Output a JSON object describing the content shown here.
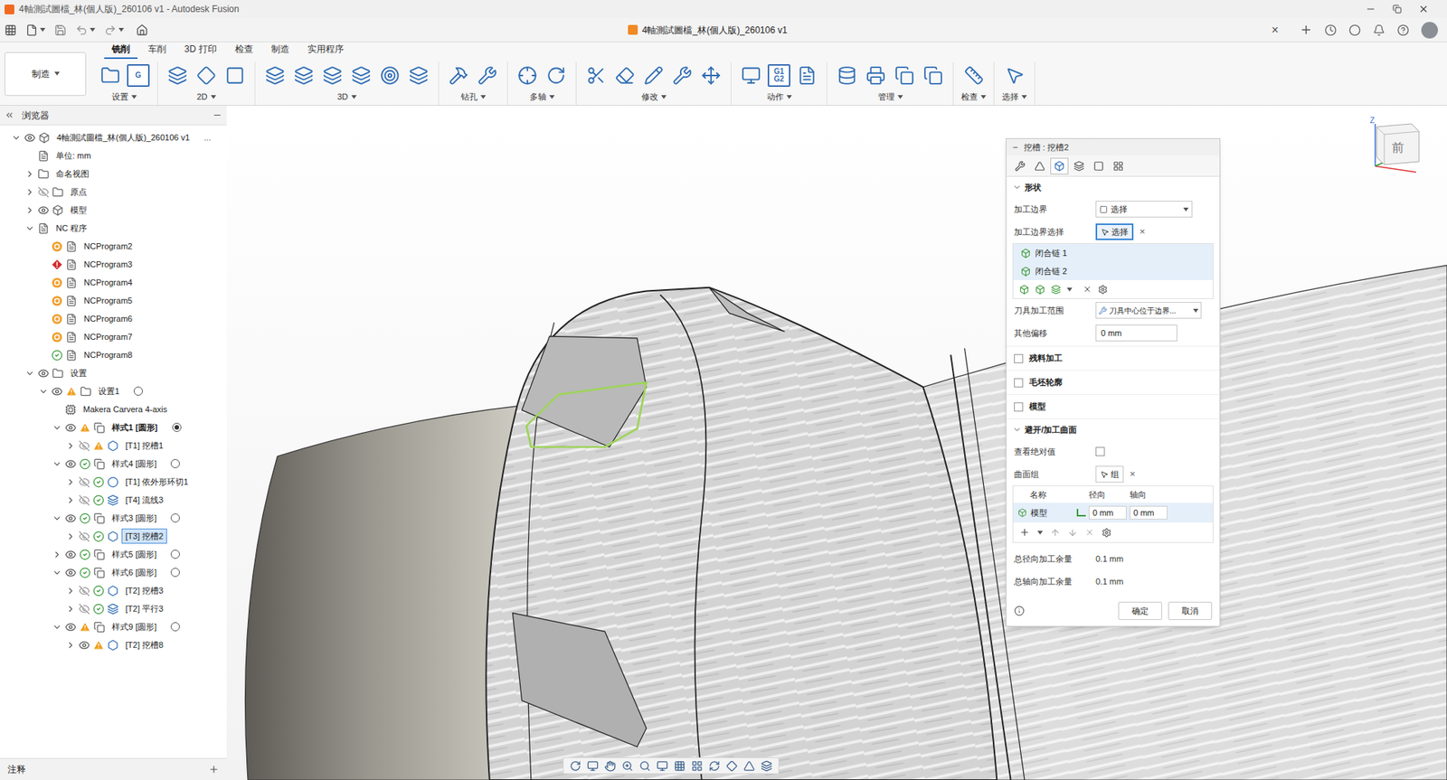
{
  "window": {
    "title": "4軸測試圖檔_林(個人版)_260106 v1 - Autodesk Fusion"
  },
  "document_tab": {
    "title": "4軸測試圖檔_林(個人版)_260106 v1",
    "close": "×"
  },
  "workspace": "制造",
  "ribbon_tabs": [
    {
      "label": "铣削",
      "selected": true
    },
    {
      "label": "车削",
      "selected": false
    },
    {
      "label": "3D 打印",
      "selected": false
    },
    {
      "label": "检查",
      "selected": false
    },
    {
      "label": "制造",
      "selected": false
    },
    {
      "label": "实用程序",
      "selected": false
    }
  ],
  "ribbon_groups": [
    {
      "label": "设置",
      "tools": [
        {
          "kind": "setup"
        },
        {
          "kind": "nc-program",
          "text": "G"
        }
      ]
    },
    {
      "label": "2D",
      "tools": [
        {
          "kind": "adaptive2d"
        },
        {
          "kind": "pocket2d"
        },
        {
          "kind": "face"
        }
      ]
    },
    {
      "label": "3D",
      "tools": [
        {
          "kind": "adaptive"
        },
        {
          "kind": "pocket"
        },
        {
          "kind": "steep"
        },
        {
          "kind": "flow"
        },
        {
          "kind": "radial"
        },
        {
          "kind": "parallel"
        }
      ]
    },
    {
      "label": "钻孔",
      "tools": [
        {
          "kind": "drill"
        },
        {
          "kind": "bore"
        }
      ]
    },
    {
      "label": "多轴",
      "tools": [
        {
          "kind": "swarf"
        },
        {
          "kind": "rotary"
        }
      ]
    },
    {
      "label": "修改",
      "tools": [
        {
          "kind": "trim"
        },
        {
          "kind": "delete"
        },
        {
          "kind": "edit"
        },
        {
          "kind": "tool-adjust"
        },
        {
          "kind": "move"
        }
      ]
    },
    {
      "label": "动作",
      "tools": [
        {
          "kind": "simulate"
        },
        {
          "kind": "post",
          "text": "G1 G2"
        },
        {
          "kind": "sheet"
        }
      ]
    },
    {
      "label": "管理",
      "tools": [
        {
          "kind": "library"
        },
        {
          "kind": "machine"
        },
        {
          "kind": "template"
        },
        {
          "kind": "copy"
        }
      ]
    },
    {
      "label": "检查",
      "tools": [
        {
          "kind": "measure"
        }
      ]
    },
    {
      "label": "选择",
      "tools": [
        {
          "kind": "select"
        }
      ]
    }
  ],
  "browser": {
    "title": "浏览器",
    "items": [
      {
        "label": "4軸測試圖檔_林(個人版)_260106 v1",
        "more": "...",
        "level": 0,
        "expanded": true,
        "eye": "visible",
        "status": null,
        "icon": "doc",
        "radio": null,
        "selected": false,
        "bold": false
      },
      {
        "label": "单位: mm",
        "level": 1,
        "expanded": null,
        "eye": null,
        "status": null,
        "icon": "units",
        "radio": null,
        "selected": false,
        "bold": false
      },
      {
        "label": "命名视图",
        "level": 1,
        "expanded": false,
        "eye": null,
        "status": null,
        "icon": "folder",
        "radio": null,
        "selected": false,
        "bold": false
      },
      {
        "label": "原点",
        "level": 1,
        "expanded": false,
        "eye": "hidden",
        "status": null,
        "icon": "folder",
        "radio": null,
        "selected": false,
        "bold": false
      },
      {
        "label": "模型",
        "level": 1,
        "expanded": false,
        "eye": "visible",
        "status": null,
        "icon": "component",
        "radio": null,
        "selected": false,
        "bold": false
      },
      {
        "label": "NC 程序",
        "level": 1,
        "expanded": true,
        "eye": null,
        "status": null,
        "icon": "nc-folder",
        "radio": null,
        "selected": false,
        "bold": false
      },
      {
        "label": "NCProgram2",
        "level": 2,
        "expanded": null,
        "eye": null,
        "status": "caution",
        "icon": "nc",
        "radio": null,
        "selected": false,
        "bold": false
      },
      {
        "label": "NCProgram3",
        "level": 2,
        "expanded": null,
        "eye": null,
        "status": "error",
        "icon": "nc",
        "radio": null,
        "selected": false,
        "bold": false
      },
      {
        "label": "NCProgram4",
        "level": 2,
        "expanded": null,
        "eye": null,
        "status": "caution",
        "icon": "nc",
        "radio": null,
        "selected": false,
        "bold": false
      },
      {
        "label": "NCProgram5",
        "level": 2,
        "expanded": null,
        "eye": null,
        "status": "caution",
        "icon": "nc",
        "radio": null,
        "selected": false,
        "bold": false
      },
      {
        "label": "NCProgram6",
        "level": 2,
        "expanded": null,
        "eye": null,
        "status": "caution",
        "icon": "nc",
        "radio": null,
        "selected": false,
        "bold": false
      },
      {
        "label": "NCProgram7",
        "level": 2,
        "expanded": null,
        "eye": null,
        "status": "caution",
        "icon": "nc",
        "radio": null,
        "selected": false,
        "bold": false
      },
      {
        "label": "NCProgram8",
        "level": 2,
        "expanded": null,
        "eye": null,
        "status": "ok",
        "icon": "nc",
        "radio": null,
        "selected": false,
        "bold": false
      },
      {
        "label": "设置",
        "level": 1,
        "expanded": true,
        "eye": "visible",
        "status": null,
        "icon": "setups",
        "radio": null,
        "selected": false,
        "bold": false
      },
      {
        "label": "设置1",
        "level": 2,
        "expanded": true,
        "eye": "visible",
        "status": "warning",
        "icon": "setup",
        "radio": "inactive",
        "selected": false,
        "bold": false
      },
      {
        "label": "Makera Carvera 4-axis",
        "level": 3,
        "expanded": null,
        "eye": null,
        "status": null,
        "icon": "machine",
        "radio": null,
        "selected": false,
        "bold": false
      },
      {
        "label": "样式1 [圆形]",
        "level": 3,
        "expanded": true,
        "eye": "visible",
        "status": "warning",
        "icon": "pattern",
        "radio": "active",
        "selected": false,
        "bold": true
      },
      {
        "label": "[T1] 挖槽1",
        "level": 4,
        "expanded": false,
        "eye": "hidden",
        "status": "warning",
        "icon": "pocket",
        "radio": null,
        "selected": false,
        "bold": false
      },
      {
        "label": "样式4 [圆形]",
        "level": 3,
        "expanded": true,
        "eye": "visible",
        "status": "ok",
        "icon": "pattern",
        "radio": "inactive",
        "selected": false,
        "bold": false
      },
      {
        "label": "[T1] 依外形环切1",
        "level": 4,
        "expanded": false,
        "eye": "hidden",
        "status": "ok",
        "icon": "contour",
        "radio": null,
        "selected": false,
        "bold": false
      },
      {
        "label": "[T4] 流线3",
        "level": 4,
        "expanded": false,
        "eye": "hidden",
        "status": "ok",
        "icon": "flow",
        "radio": null,
        "selected": false,
        "bold": false
      },
      {
        "label": "样式3 [圆形]",
        "level": 3,
        "expanded": true,
        "eye": "visible",
        "status": "ok",
        "icon": "pattern",
        "radio": "inactive",
        "selected": false,
        "bold": false
      },
      {
        "label": "[T3] 挖槽2",
        "level": 4,
        "expanded": false,
        "eye": "hidden",
        "status": "ok",
        "icon": "pocket",
        "radio": null,
        "selected": true,
        "bold": false
      },
      {
        "label": "样式5 [圆形]",
        "level": 3,
        "expanded": false,
        "eye": "visible",
        "status": "ok",
        "icon": "pattern",
        "radio": "inactive",
        "selected": false,
        "bold": false
      },
      {
        "label": "样式6 [圆形]",
        "level": 3,
        "expanded": true,
        "eye": "visible",
        "status": "ok",
        "icon": "pattern",
        "radio": "inactive",
        "selected": false,
        "bold": false
      },
      {
        "label": "[T2] 挖槽3",
        "level": 4,
        "expanded": false,
        "eye": "hidden",
        "status": "ok",
        "icon": "pocket",
        "radio": null,
        "selected": false,
        "bold": false
      },
      {
        "label": "[T2] 平行3",
        "level": 4,
        "expanded": false,
        "eye": "hidden",
        "status": "ok",
        "icon": "parallel",
        "radio": null,
        "selected": false,
        "bold": false
      },
      {
        "label": "样式9 [圆形]",
        "level": 3,
        "expanded": true,
        "eye": "visible",
        "status": "warning",
        "icon": "pattern",
        "radio": "inactive",
        "selected": false,
        "bold": false
      },
      {
        "label": "[T2] 挖槽8",
        "level": 4,
        "expanded": false,
        "eye": "visible",
        "status": "warning",
        "icon": "pocket",
        "radio": null,
        "selected": false,
        "bold": false
      }
    ]
  },
  "comments_panel": {
    "title": "注释"
  },
  "dialog": {
    "title": "挖槽 : 挖槽2",
    "collapse": "−",
    "tabs": [
      {
        "kind": "tool",
        "selected": false
      },
      {
        "kind": "geometry",
        "selected": false
      },
      {
        "kind": "shape",
        "selected": true
      },
      {
        "kind": "heights",
        "selected": false
      },
      {
        "kind": "passes",
        "selected": false
      },
      {
        "kind": "linking",
        "selected": false
      }
    ],
    "shape_section": {
      "title": "形状",
      "expanded": true
    },
    "boundary_mode": {
      "label": "加工边界",
      "value": "选择"
    },
    "boundary_selection": {
      "label": "加工边界选择",
      "button": "选择",
      "clear": "×"
    },
    "chains": [
      {
        "label": "闭合链 1",
        "selected": true
      },
      {
        "label": "闭合链 2",
        "selected": true
      }
    ],
    "tool_containment": {
      "label": "刀具加工范围",
      "value": "刀具中心位于边界..."
    },
    "additional_offset": {
      "label": "其他偏移",
      "value": "0 mm"
    },
    "options": [
      {
        "label": "残料加工",
        "checked": false
      },
      {
        "label": "毛坯轮廓",
        "checked": false
      },
      {
        "label": "模型",
        "checked": false
      }
    ],
    "avoid_section": {
      "title": "避开/加工曲面",
      "expanded": true
    },
    "show_absolute": {
      "label": "查看绝对值",
      "checked": false
    },
    "surface_groups": {
      "label": "曲面组",
      "button": "组",
      "clear": "×"
    },
    "surface_table": {
      "columns": [
        "名称",
        "径向",
        "轴向"
      ],
      "rows": [
        {
          "name": "模型",
          "radial": "0 mm",
          "axial": "0 mm",
          "selected": true
        }
      ]
    },
    "totals": [
      {
        "label": "总径向加工余量",
        "value": "0.1 mm"
      },
      {
        "label": "总轴向加工余量",
        "value": "0.1 mm"
      }
    ],
    "buttons": [
      "确定",
      "取消"
    ]
  },
  "view_cube": {
    "face": "前",
    "axis_label": "Z"
  },
  "nav_toolbar": [
    "orbit",
    "look",
    "pan",
    "zoom",
    "fit",
    "display",
    "grid",
    "viewports",
    "refresh",
    "effects",
    "filter",
    "section"
  ]
}
